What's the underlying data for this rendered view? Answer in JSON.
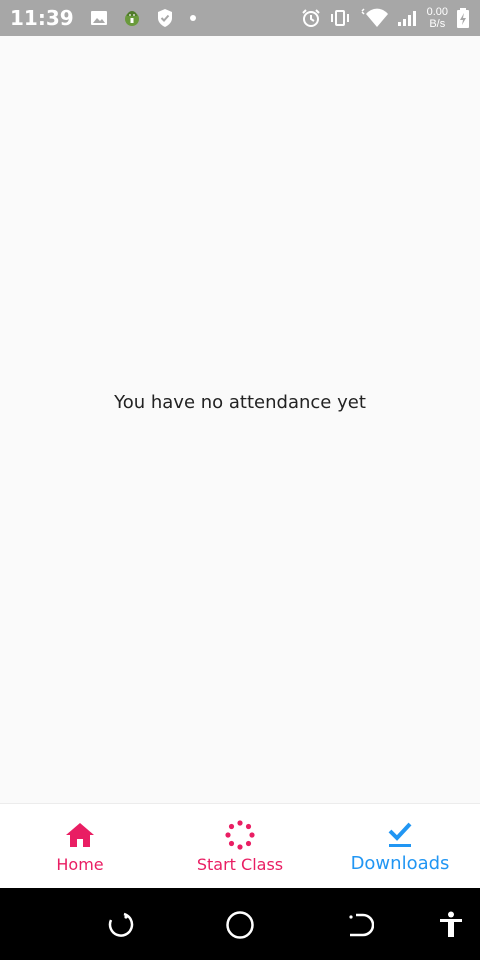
{
  "status_bar": {
    "time": "11:39",
    "net_speed_value": "0.00",
    "net_speed_unit": "B/s",
    "icons_left": [
      "image-icon",
      "android-debug-icon",
      "shield-check-icon",
      "dot-icon"
    ],
    "icons_right": [
      "alarm-icon",
      "vibrate-icon",
      "wifi-icon",
      "signal-icon",
      "battery-icon"
    ]
  },
  "main": {
    "empty_message": "You have no attendance yet"
  },
  "bottom_nav": {
    "items": [
      {
        "label": "Home",
        "icon": "home-icon",
        "color": "#e91e63",
        "active": false
      },
      {
        "label": "Start Class",
        "icon": "loading-spinner-icon",
        "color": "#e91e63",
        "active": false
      },
      {
        "label": "Downloads",
        "icon": "check-download-icon",
        "color": "#2196f3",
        "active": true
      }
    ]
  },
  "system_nav": {
    "buttons": [
      "back-icon",
      "home-circle-icon",
      "recents-icon",
      "accessibility-icon"
    ]
  },
  "colors": {
    "status_bar_bg": "#a7a7a7",
    "accent_pink": "#e91e63",
    "accent_blue": "#2196f3",
    "background": "#fafafa"
  }
}
